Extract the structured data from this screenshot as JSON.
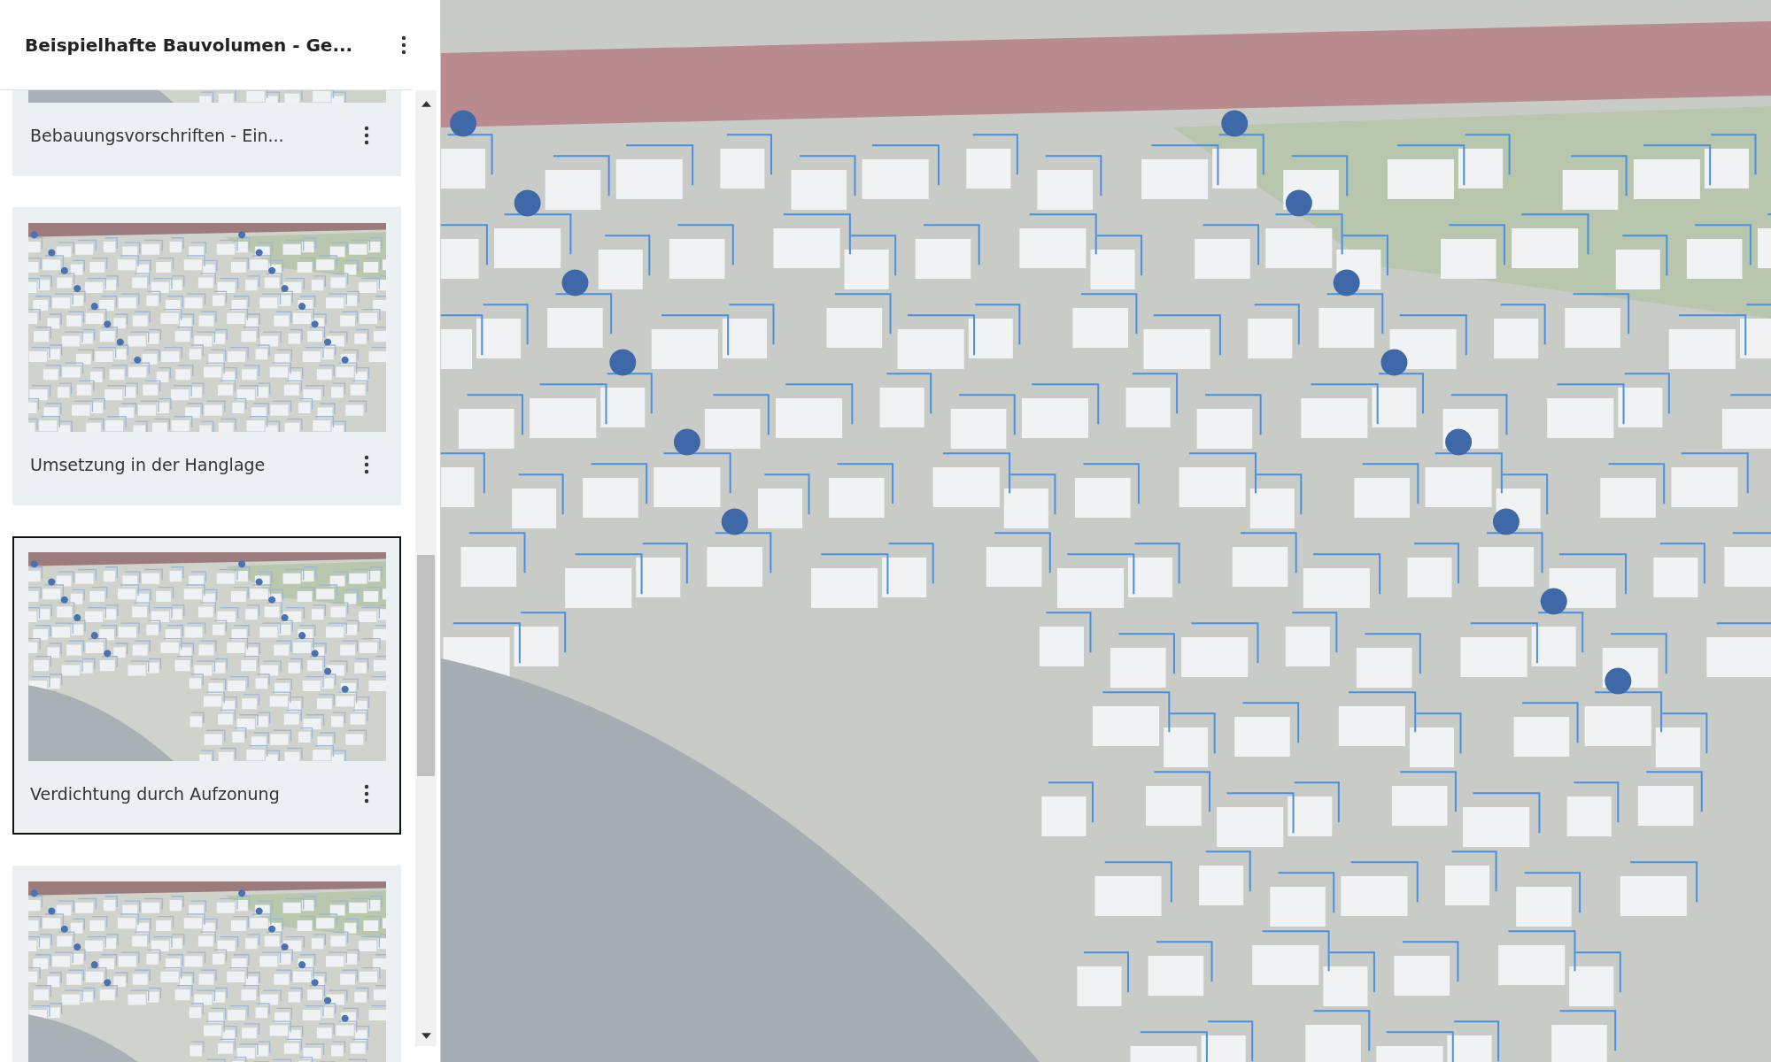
{
  "header": {
    "title": "Beispielhafte Bauvolumen - Ge..."
  },
  "slides": [
    {
      "title": "Bebauungsvorschriften - Ein...",
      "selected": false
    },
    {
      "title": "Umsetzung in der Hanglage",
      "selected": false
    },
    {
      "title": "Verdichtung durch Aufzonung",
      "selected": true
    },
    {
      "selected": false
    }
  ]
}
